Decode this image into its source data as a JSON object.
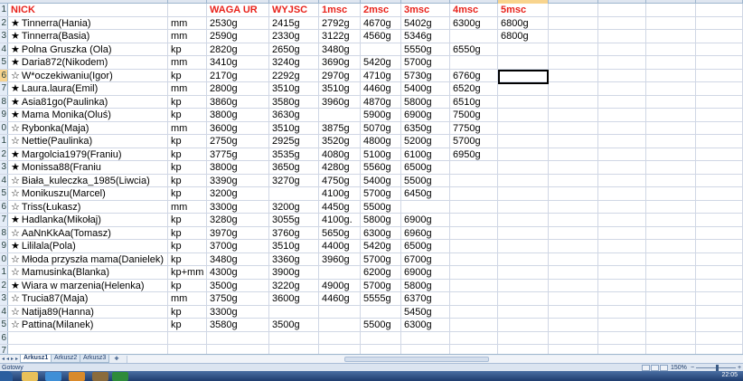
{
  "columns": {
    "letters": [
      "A",
      "",
      "",
      "",
      "",
      "",
      "",
      "",
      "",
      "",
      "",
      "",
      "",
      "",
      ""
    ],
    "active_letter": "K"
  },
  "headers": {
    "nick": "NICK",
    "weight_birth": "WAGA UR",
    "weight_discharge": "WYJSC",
    "m1": "1msc",
    "m2": "2msc",
    "m3": "3msc",
    "m4": "4msc",
    "m5": "5msc"
  },
  "rows": [
    {
      "rownum": "2",
      "star": "★",
      "nick": "Tinnerra(Hania)",
      "type": "mm",
      "ur": "2530g",
      "wyjsc": "2415g",
      "m1": "2792g",
      "m2": "4670g",
      "m3": "5402g",
      "m4": "6300g",
      "m5": "6800g"
    },
    {
      "rownum": "3",
      "star": "★",
      "nick": "Tinnerra(Basia)",
      "type": "mm",
      "ur": "2590g",
      "wyjsc": "2330g",
      "m1": "3122g",
      "m2": "4560g",
      "m3": "5346g",
      "m4": "",
      "m5": "6800g"
    },
    {
      "rownum": "4",
      "star": "★",
      "nick": "Polna Gruszka (Ola)",
      "type": "kp",
      "ur": "2820g",
      "wyjsc": "2650g",
      "m1": "3480g",
      "m2": "",
      "m3": "5550g",
      "m4": "6550g",
      "m5": ""
    },
    {
      "rownum": "5",
      "star": "★",
      "nick": "Daria872(Nikodem)",
      "type": "mm",
      "ur": "3410g",
      "wyjsc": "3240g",
      "m1": "3690g",
      "m2": "5420g",
      "m3": "5700g",
      "m4": "",
      "m5": ""
    },
    {
      "rownum": "6",
      "star": "☆",
      "nick": "W*oczekiwaniu(Igor)",
      "type": "kp",
      "ur": "2170g",
      "wyjsc": "2292g",
      "m1": "2970g",
      "m2": "4710g",
      "m3": "5730g",
      "m4": "6760g",
      "m5": ""
    },
    {
      "rownum": "7",
      "star": "★",
      "nick": "Laura.laura(Emil)",
      "type": "mm",
      "ur": "2800g",
      "wyjsc": "3510g",
      "m1": "3510g",
      "m2": "4460g",
      "m3": "5400g",
      "m4": "6520g",
      "m5": ""
    },
    {
      "rownum": "8",
      "star": "★",
      "nick": "Asia81go(Paulinka)",
      "type": "kp",
      "ur": "3860g",
      "wyjsc": "3580g",
      "m1": "3960g",
      "m2": "4870g",
      "m3": "5800g",
      "m4": "6510g",
      "m5": ""
    },
    {
      "rownum": "9",
      "star": "★",
      "nick": "Mama Monika(Oluś)",
      "type": "kp",
      "ur": "3800g",
      "wyjsc": "3630g",
      "m1": "",
      "m2": "5900g",
      "m3": "6900g",
      "m4": "7500g",
      "m5": ""
    },
    {
      "rownum": "0",
      "star": "☆",
      "nick": "Rybonka(Maja)",
      "type": "mm",
      "ur": "3600g",
      "wyjsc": "3510g",
      "m1": "3875g",
      "m2": "5070g",
      "m3": "6350g",
      "m4": "7750g",
      "m5": ""
    },
    {
      "rownum": "1",
      "star": "☆",
      "nick": "Nettie(Paulinka)",
      "type": "kp",
      "ur": "2750g",
      "wyjsc": "2925g",
      "m1": "3520g",
      "m2": "4800g",
      "m3": "5200g",
      "m4": "5700g",
      "m5": ""
    },
    {
      "rownum": "2",
      "star": "★",
      "nick": "Margolcia1979(Franiu)",
      "type": "kp",
      "ur": "3775g",
      "wyjsc": "3535g",
      "m1": "4080g",
      "m2": "5100g",
      "m3": "6100g",
      "m4": "6950g",
      "m5": ""
    },
    {
      "rownum": "3",
      "star": "★",
      "nick": "Monissa88(Franiu",
      "type": "kp",
      "ur": "3800g",
      "wyjsc": "3650g",
      "m1": "4280g",
      "m2": "5560g",
      "m3": "6500g",
      "m4": "",
      "m5": ""
    },
    {
      "rownum": "4",
      "star": "☆",
      "nick": "Biała_kuleczka_1985(Liwcia)",
      "type": "kp",
      "ur": "3390g",
      "wyjsc": "3270g",
      "m1": "4750g",
      "m2": "5400g",
      "m3": "5500g",
      "m4": "",
      "m5": ""
    },
    {
      "rownum": "5",
      "star": "☆",
      "nick": "Monikuszu(Marcel)",
      "type": "kp",
      "ur": "3200g",
      "wyjsc": "",
      "m1": "4100g",
      "m2": "5700g",
      "m3": "6450g",
      "m4": "",
      "m5": ""
    },
    {
      "rownum": "6",
      "star": "☆",
      "nick": "Triss(Łukasz)",
      "type": "mm",
      "ur": "3300g",
      "wyjsc": "3200g",
      "m1": "4450g",
      "m2": "5500g",
      "m3": "",
      "m4": "",
      "m5": ""
    },
    {
      "rownum": "7",
      "star": "★",
      "nick": "Hadlanka(Mikołaj)",
      "type": "kp",
      "ur": "3280g",
      "wyjsc": "3055g",
      "m1": "4100g.",
      "m2": "5800g",
      "m3": "6900g",
      "m4": "",
      "m5": ""
    },
    {
      "rownum": "8",
      "star": "☆",
      "nick": "AaNnKkAa(Tomasz)",
      "type": "kp",
      "ur": "3970g",
      "wyjsc": "3760g",
      "m1": "5650g",
      "m2": "6300g",
      "m3": "6960g",
      "m4": "",
      "m5": ""
    },
    {
      "rownum": "9",
      "star": "★",
      "nick": "Lililala(Pola)",
      "type": "kp",
      "ur": "3700g",
      "wyjsc": "3510g",
      "m1": "4400g",
      "m2": "5420g",
      "m3": "6500g",
      "m4": "",
      "m5": ""
    },
    {
      "rownum": "0",
      "star": "☆",
      "nick": "Młoda przyszła mama(Danielek)",
      "type": "kp",
      "ur": "3480g",
      "wyjsc": "3360g",
      "m1": "3960g",
      "m2": "5700g",
      "m3": "6700g",
      "m4": "",
      "m5": ""
    },
    {
      "rownum": "1",
      "star": "☆",
      "nick": "Mamusinka(Blanka)",
      "type": "kp+mm",
      "ur": "4300g",
      "wyjsc": "3900g",
      "m1": "",
      "m2": "6200g",
      "m3": "6900g",
      "m4": "",
      "m5": ""
    },
    {
      "rownum": "2",
      "star": "★",
      "nick": "Wiara w marzenia(Helenka)",
      "type": "kp",
      "ur": "3500g",
      "wyjsc": "3220g",
      "m1": "4900g",
      "m2": "5700g",
      "m3": "5800g",
      "m4": "",
      "m5": ""
    },
    {
      "rownum": "3",
      "star": "☆",
      "nick": "Trucia87(Maja)",
      "type": "mm",
      "ur": "3750g",
      "wyjsc": "3600g",
      "m1": "4460g",
      "m2": "5555g",
      "m3": "6370g",
      "m4": "",
      "m5": ""
    },
    {
      "rownum": "4",
      "star": "☆",
      "nick": "Natija89(Hanna)",
      "type": "kp",
      "ur": "3300g",
      "wyjsc": "",
      "m1": "",
      "m2": "",
      "m3": "5450g",
      "m4": "",
      "m5": ""
    },
    {
      "rownum": "5",
      "star": "☆",
      "nick": "Pattina(Milanek)",
      "type": "kp",
      "ur": "3580g",
      "wyjsc": "3500g",
      "m1": "",
      "m2": "5500g",
      "m3": "6300g",
      "m4": "",
      "m5": ""
    },
    {
      "rownum": "6",
      "star": "",
      "nick": "",
      "type": "",
      "ur": "",
      "wyjsc": "",
      "m1": "",
      "m2": "",
      "m3": "",
      "m4": "",
      "m5": ""
    },
    {
      "rownum": "7",
      "star": "",
      "nick": "",
      "type": "",
      "ur": "",
      "wyjsc": "",
      "m1": "",
      "m2": "",
      "m3": "",
      "m4": "",
      "m5": ""
    }
  ],
  "header_rownum": "1",
  "active_rownum_index": 4,
  "sheet_tabs": [
    {
      "label": "Arkusz1",
      "active": true
    },
    {
      "label": "Arkusz2",
      "active": false
    },
    {
      "label": "Arkusz3",
      "active": false
    }
  ],
  "status": {
    "text": "Gotowy",
    "zoom": "150%",
    "clock": "22:05"
  },
  "colors": {
    "header_text": "#e8231c",
    "grid": "#d0d7e5",
    "rownum_bg": "#e4ecf7",
    "active_header": "#f8d48e"
  }
}
